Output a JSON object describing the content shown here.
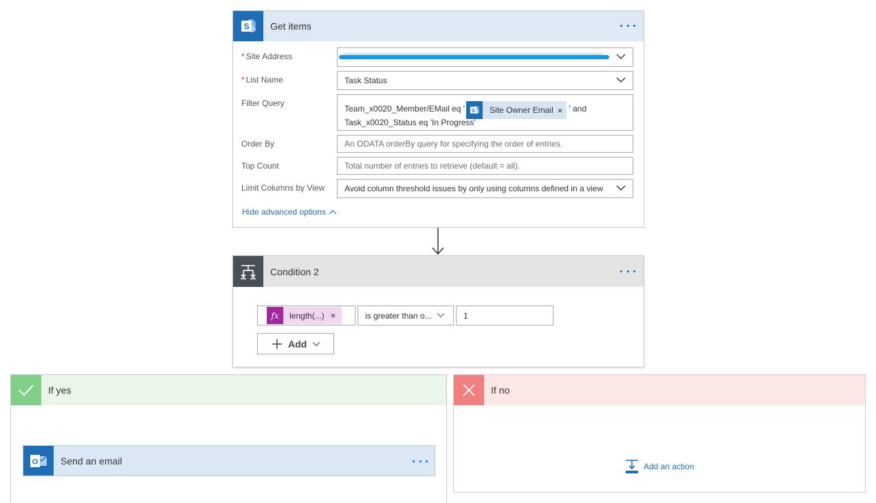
{
  "get_items": {
    "title": "Get items",
    "fields": {
      "site_address": {
        "label": "Site Address",
        "required": "*"
      },
      "list_name": {
        "label": "List Name",
        "required": "*",
        "value": "Task Status"
      },
      "filter_query": {
        "label": "Filter Query",
        "prefix": "Team_x0020_Member/EMail eq '",
        "token": "Site Owner Email",
        "suffix": "' and",
        "line2": "Task_x0020_Status eq 'In Progress'"
      },
      "order_by": {
        "label": "Order By",
        "placeholder": "An ODATA orderBy query for specifying the order of entries."
      },
      "top_count": {
        "label": "Top Count",
        "placeholder": "Total number of entries to retrieve (default = all)."
      },
      "limit_columns": {
        "label": "Limit Columns by View",
        "placeholder": "Avoid column threshold issues by only using columns defined in a view"
      }
    },
    "advanced_link": "Hide advanced options"
  },
  "condition": {
    "title": "Condition 2",
    "operand_token": "length(...)",
    "operator": "is greater than o...",
    "value": "1",
    "add_label": "Add"
  },
  "if_yes": {
    "title": "If yes",
    "action_title": "Send an email"
  },
  "if_no": {
    "title": "If no",
    "add_action": "Add an action"
  },
  "colors": {
    "accent": "#1e6db5",
    "yes_green": "#7fcf86",
    "no_red": "#f07f7f",
    "fx_purple": "#a2269c"
  },
  "icons": [
    "sharepoint-icon",
    "condition-icon",
    "checkmark-icon",
    "close-icon",
    "outlook-icon",
    "more-options-icon",
    "chevron-down-icon",
    "add-action-icon"
  ]
}
